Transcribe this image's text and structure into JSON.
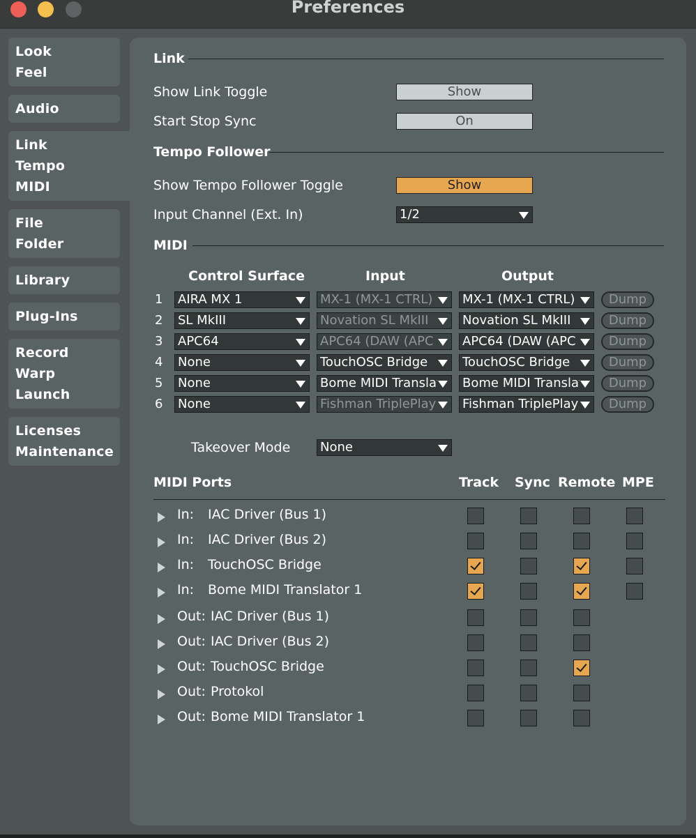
{
  "window": {
    "title": "Preferences"
  },
  "sidebar": [
    {
      "lines": [
        "Look",
        "Feel"
      ]
    },
    {
      "lines": [
        "Audio"
      ]
    },
    {
      "lines": [
        "Link",
        "Tempo",
        "MIDI"
      ]
    },
    {
      "lines": [
        "File",
        "Folder"
      ]
    },
    {
      "lines": [
        "Library"
      ]
    },
    {
      "lines": [
        "Plug-Ins"
      ]
    },
    {
      "lines": [
        "Record",
        "Warp",
        "Launch"
      ]
    },
    {
      "lines": [
        "Licenses",
        "Maintenance"
      ]
    }
  ],
  "active_tab": "Link Tempo MIDI",
  "link": {
    "section_title": "Link",
    "show_toggle_label": "Show Link Toggle",
    "show_toggle_value": "Show",
    "start_stop_label": "Start Stop Sync",
    "start_stop_value": "On"
  },
  "tempo": {
    "section_title": "Tempo Follower",
    "show_toggle_label": "Show Tempo Follower Toggle",
    "show_toggle_value": "Show",
    "input_channel_label": "Input Channel (Ext. In)",
    "input_channel_value": "1/2"
  },
  "midi": {
    "section_title": "MIDI",
    "headers": {
      "surface": "Control Surface",
      "input": "Input",
      "output": "Output"
    },
    "rows": [
      {
        "num": "1",
        "surface": "AIRA MX 1",
        "input": "MX-1 (MX-1 CTRL)",
        "output": "MX-1 (MX-1 CTRL)",
        "dump": "Dump"
      },
      {
        "num": "2",
        "surface": "SL MkIII",
        "input": "Novation SL MkIII",
        "output": "Novation SL MkIII",
        "dump": "Dump"
      },
      {
        "num": "3",
        "surface": "APC64",
        "input": "APC64 (DAW (APC",
        "output": "APC64 (DAW (APC",
        "dump": "Dump"
      },
      {
        "num": "4",
        "surface": "None",
        "input": "TouchOSC Bridge",
        "output": "TouchOSC Bridge",
        "dump": "Dump"
      },
      {
        "num": "5",
        "surface": "None",
        "input": "Bome MIDI Translator",
        "output": "Bome MIDI Translator",
        "dump": "Dump"
      },
      {
        "num": "6",
        "surface": "None",
        "input": "Fishman TriplePlay",
        "output": "Fishman TriplePlay",
        "dump": "Dump"
      }
    ],
    "takeover_label": "Takeover Mode",
    "takeover_value": "None"
  },
  "ports": {
    "title": "MIDI Ports",
    "headers": {
      "track": "Track",
      "sync": "Sync",
      "remote": "Remote",
      "mpe": "MPE"
    },
    "rows": [
      {
        "dir": "In:",
        "name": "IAC Driver (Bus 1)",
        "track": false,
        "sync": false,
        "remote": false,
        "mpe": false
      },
      {
        "dir": "In:",
        "name": "IAC Driver (Bus 2)",
        "track": false,
        "sync": false,
        "remote": false,
        "mpe": false
      },
      {
        "dir": "In:",
        "name": "TouchOSC Bridge",
        "track": true,
        "sync": false,
        "remote": true,
        "mpe": false
      },
      {
        "dir": "In:",
        "name": "Bome MIDI Translator 1",
        "track": true,
        "sync": false,
        "remote": true,
        "mpe": false
      },
      {
        "dir": "Out:",
        "name": "IAC Driver (Bus 1)",
        "track": false,
        "sync": false,
        "remote": false,
        "mpe": null
      },
      {
        "dir": "Out:",
        "name": "IAC Driver (Bus 2)",
        "track": false,
        "sync": false,
        "remote": false,
        "mpe": null
      },
      {
        "dir": "Out:",
        "name": "TouchOSC Bridge",
        "track": false,
        "sync": false,
        "remote": true,
        "mpe": null
      },
      {
        "dir": "Out:",
        "name": "Protokol",
        "track": false,
        "sync": false,
        "remote": false,
        "mpe": null
      },
      {
        "dir": "Out:",
        "name": "Bome MIDI Translator 1",
        "track": false,
        "sync": false,
        "remote": false,
        "mpe": null
      }
    ]
  },
  "colors": {
    "accent": "#e7a750",
    "panel": "#5a6363",
    "background": "#4e5454"
  }
}
